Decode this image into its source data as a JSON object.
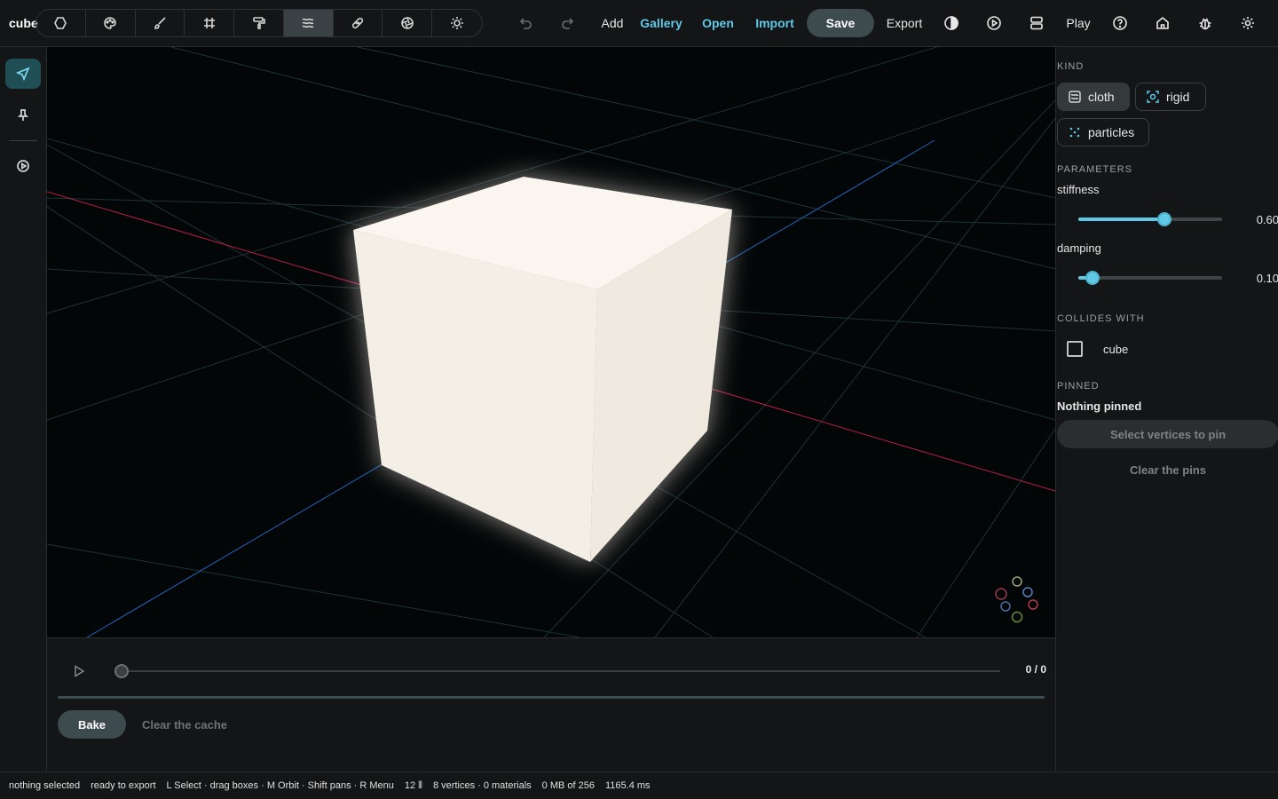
{
  "app": {
    "title": "cube"
  },
  "tools": [
    {
      "name": "lasso-icon",
      "active": false
    },
    {
      "name": "palette-icon",
      "active": false
    },
    {
      "name": "brush-icon",
      "active": false
    },
    {
      "name": "grid-icon",
      "active": false
    },
    {
      "name": "paint-roller-icon",
      "active": false
    },
    {
      "name": "cloth-waves-icon",
      "active": true
    },
    {
      "name": "bandage-icon",
      "active": false
    },
    {
      "name": "aperture-icon",
      "active": false
    },
    {
      "name": "sun-icon",
      "active": false
    }
  ],
  "toolbar": {
    "add": "Add",
    "gallery": "Gallery",
    "open": "Open",
    "import": "Import",
    "save": "Save",
    "export": "Export",
    "play": "Play"
  },
  "panel": {
    "kind_heading": "KIND",
    "kinds": {
      "cloth": "cloth",
      "rigid": "rigid",
      "particles": "particles"
    },
    "parameters_heading": "PARAMETERS",
    "stiffness": {
      "label": "stiffness",
      "value": 0.6,
      "display": "0.60"
    },
    "damping": {
      "label": "damping",
      "value": 0.1,
      "display": "0.10"
    },
    "collides_heading": "COLLIDES WITH",
    "collides_item": "cube",
    "pinned_heading": "PINNED",
    "pinned_status": "Nothing pinned",
    "select_vertices": "Select vertices to pin",
    "clear_pins": "Clear the pins"
  },
  "timeline": {
    "frame_counter": "0 / 0",
    "bake": "Bake",
    "clear_cache": "Clear the cache",
    "progress": 0
  },
  "status": {
    "selection": "nothing selected",
    "export_state": "ready to export",
    "hints": "L Select · drag boxes · M Orbit · Shift pans · R Menu",
    "fps": "12 ⦀",
    "geometry": "8 vertices · 0 materials",
    "memory": "0 MB of 256",
    "frame_time": "1165.4 ms"
  },
  "colors": {
    "accent": "#5ec8e6",
    "axis_x": "#c0224a",
    "axis_z": "#2a6fd0",
    "cube": "#f5efe6"
  }
}
